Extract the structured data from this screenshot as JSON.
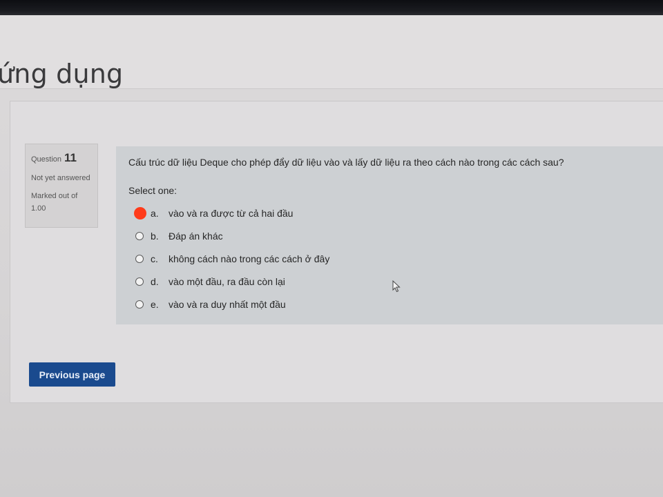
{
  "header": {
    "title": "ứng dụng"
  },
  "question": {
    "label": "Question",
    "number": "11",
    "state": "Not yet answered",
    "grade": "Marked out of 1.00",
    "text": "Cấu trúc dữ liệu Deque cho phép đẩy dữ liệu vào và lấy dữ liệu ra theo cách nào trong các cách sau?",
    "prompt": "Select one:",
    "answers": [
      {
        "letter": "a.",
        "text": "vào và ra được từ cả hai đầu",
        "selected": true
      },
      {
        "letter": "b.",
        "text": "Đáp án khác",
        "selected": false
      },
      {
        "letter": "c.",
        "text": "không cách nào trong các cách ở đây",
        "selected": false
      },
      {
        "letter": "d.",
        "text": "vào một đầu, ra đầu còn lại",
        "selected": false
      },
      {
        "letter": "e.",
        "text": "vào và ra duy nhất một đầu",
        "selected": false
      }
    ]
  },
  "navigation": {
    "previous_label": "Previous page"
  },
  "colors": {
    "primary_button": "#1a4a8e",
    "selected_marker": "#ff3b1a",
    "question_bg": "#cdd0d3"
  }
}
